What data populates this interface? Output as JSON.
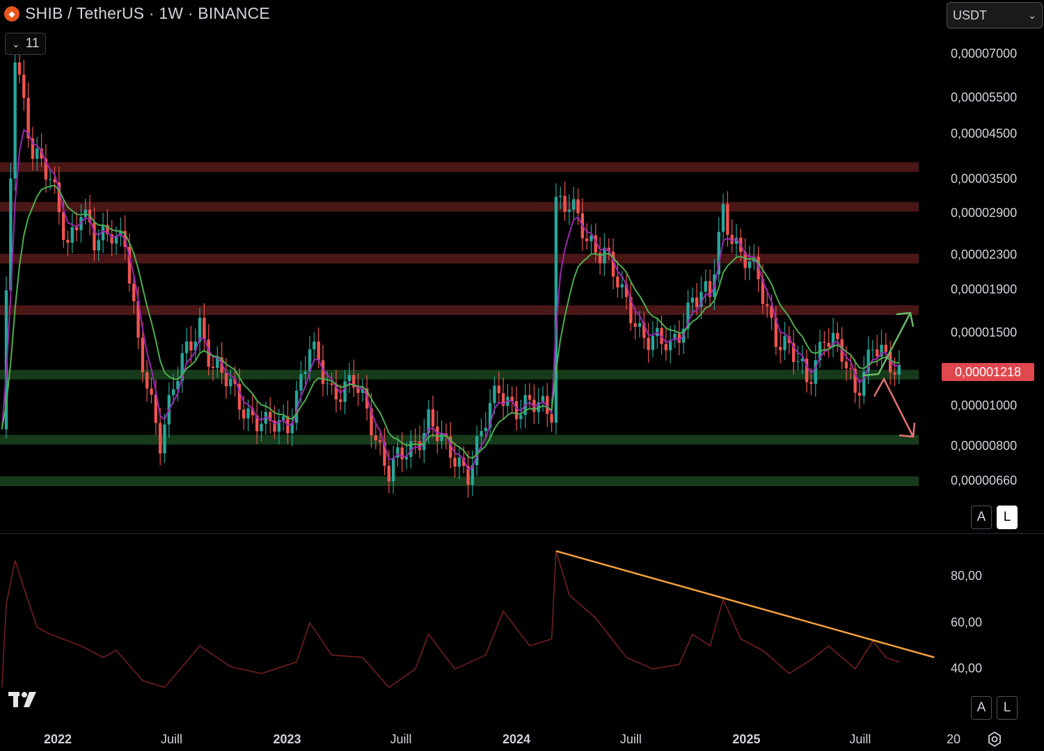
{
  "header": {
    "title": "SHIB / TetherUS · 1W · BINANCE",
    "indicator_count": "11",
    "symbol_icon": "shiba-coin-icon"
  },
  "toolbar": {
    "currency": "USDT"
  },
  "price_axis": {
    "ticks": [
      "0,00007000",
      "0,00005500",
      "0,00004500",
      "0,00003500",
      "0,00002900",
      "0,00002300",
      "0,00001900",
      "0,00001500",
      "0,00001000",
      "0,00000800",
      "0,00000660"
    ],
    "current_price": "0,00001218",
    "scale_buttons": [
      "A",
      "L"
    ]
  },
  "rsi_axis": {
    "ticks": [
      "80,00",
      "60,00",
      "40,00"
    ],
    "scale_buttons": [
      "A",
      "L"
    ]
  },
  "time_axis": {
    "ticks": [
      "2022",
      "Juill",
      "2023",
      "Juill",
      "2024",
      "Juill",
      "2025",
      "Juill",
      "20"
    ]
  },
  "colors": {
    "up": "#26a69a",
    "down": "#ef5350",
    "ma_fast": "#9c27b0",
    "ma_slow": "#4caf50",
    "resistance_zone": "#4a1616",
    "support_zone": "#163a1a",
    "rsi_line": "#7a2020",
    "trendline": "#f5a13c",
    "arrow_up": "#66bb6a",
    "arrow_down": "#e57373",
    "price_tag": "#e0474f"
  },
  "chart_data": [
    {
      "type": "candlestick",
      "title": "SHIB / TetherUS · 1W · BINANCE",
      "x_range": [
        "2021-10",
        "2025-12"
      ],
      "y_scale": "log",
      "y_range": [
        5.6e-06,
        7.5e-05
      ],
      "current_price": 1.218e-05,
      "resistance_zones": [
        3.75e-05,
        3.01e-05,
        2.26e-05,
        1.7e-05
      ],
      "support_zones": [
        1.19e-05,
        8.3e-06,
        6.6e-06
      ],
      "price_path": [
        [
          "2021-10-04",
          8.5e-06
        ],
        [
          "2021-10-25",
          7e-05
        ],
        [
          "2021-11-22",
          4.2e-05
        ],
        [
          "2021-12-20",
          3.4e-05
        ],
        [
          "2022-01-17",
          2.5e-05
        ],
        [
          "2022-02-07",
          3e-05
        ],
        [
          "2022-02-28",
          2.4e-05
        ],
        [
          "2022-03-28",
          2.7e-05
        ],
        [
          "2022-04-18",
          2.5e-05
        ],
        [
          "2022-05-09",
          1.35e-05
        ],
        [
          "2022-06-13",
          8.5e-06
        ],
        [
          "2022-07-04",
          1.1e-05
        ],
        [
          "2022-08-15",
          1.6e-05
        ],
        [
          "2022-09-05",
          1.25e-05
        ],
        [
          "2022-10-03",
          1.1e-05
        ],
        [
          "2022-11-07",
          9.5e-06
        ],
        [
          "2022-11-28",
          8.8e-06
        ],
        [
          "2023-01-02",
          9.2e-06
        ],
        [
          "2023-02-06",
          1.35e-05
        ],
        [
          "2023-03-13",
          1.1e-05
        ],
        [
          "2023-04-17",
          1.12e-05
        ],
        [
          "2023-05-15",
          9.2e-06
        ],
        [
          "2023-06-12",
          7e-06
        ],
        [
          "2023-07-17",
          7.8e-06
        ],
        [
          "2023-08-14",
          9.5e-06
        ],
        [
          "2023-09-11",
          7.7e-06
        ],
        [
          "2023-10-16",
          7.1e-06
        ],
        [
          "2023-11-06",
          8.5e-06
        ],
        [
          "2023-12-04",
          1.1e-05
        ],
        [
          "2024-01-08",
          9.8e-06
        ],
        [
          "2024-02-26",
          1e-05
        ],
        [
          "2024-03-04",
          3.2e-05
        ],
        [
          "2024-03-25",
          3e-05
        ],
        [
          "2024-04-22",
          2.5e-05
        ],
        [
          "2024-05-20",
          2.4e-05
        ],
        [
          "2024-06-17",
          1.8e-05
        ],
        [
          "2024-07-15",
          1.55e-05
        ],
        [
          "2024-08-05",
          1.45e-05
        ],
        [
          "2024-09-02",
          1.35e-05
        ],
        [
          "2024-10-07",
          1.85e-05
        ],
        [
          "2024-11-04",
          1.8e-05
        ],
        [
          "2024-11-25",
          3e-05
        ],
        [
          "2024-12-23",
          2.3e-05
        ],
        [
          "2025-01-20",
          2e-05
        ],
        [
          "2025-02-17",
          1.5e-05
        ],
        [
          "2025-03-17",
          1.3e-05
        ],
        [
          "2025-04-07",
          1.15e-05
        ],
        [
          "2025-05-05",
          1.5e-05
        ],
        [
          "2025-06-02",
          1.3e-05
        ],
        [
          "2025-06-23",
          1.1e-05
        ],
        [
          "2025-07-21",
          1.4e-05
        ],
        [
          "2025-08-11",
          1.25e-05
        ],
        [
          "2025-09-01",
          1.218e-05
        ]
      ],
      "projection_arrows": [
        "up",
        "down"
      ]
    },
    {
      "type": "line",
      "title": "RSI",
      "y_range": [
        28,
        97
      ],
      "values": [
        [
          "2021-10-04",
          32
        ],
        [
          "2021-10-11",
          68
        ],
        [
          "2021-10-25",
          87
        ],
        [
          "2021-11-08",
          75
        ],
        [
          "2021-11-29",
          58
        ],
        [
          "2021-12-20",
          55
        ],
        [
          "2022-02-07",
          50
        ],
        [
          "2022-03-14",
          45
        ],
        [
          "2022-04-04",
          48
        ],
        [
          "2022-05-16",
          35
        ],
        [
          "2022-06-20",
          32
        ],
        [
          "2022-08-15",
          50
        ],
        [
          "2022-10-03",
          41
        ],
        [
          "2022-11-21",
          38
        ],
        [
          "2023-01-16",
          43
        ],
        [
          "2023-02-06",
          60
        ],
        [
          "2023-03-13",
          46
        ],
        [
          "2023-05-01",
          45
        ],
        [
          "2023-06-12",
          32
        ],
        [
          "2023-07-24",
          40
        ],
        [
          "2023-08-14",
          55
        ],
        [
          "2023-09-25",
          40
        ],
        [
          "2023-11-13",
          46
        ],
        [
          "2023-12-11",
          65
        ],
        [
          "2024-01-22",
          50
        ],
        [
          "2024-02-26",
          53
        ],
        [
          "2024-03-04",
          91
        ],
        [
          "2024-03-25",
          72
        ],
        [
          "2024-05-06",
          62
        ],
        [
          "2024-06-24",
          45
        ],
        [
          "2024-08-05",
          40
        ],
        [
          "2024-09-16",
          42
        ],
        [
          "2024-10-07",
          55
        ],
        [
          "2024-11-04",
          50
        ],
        [
          "2024-11-25",
          70
        ],
        [
          "2024-12-23",
          53
        ],
        [
          "2025-01-27",
          48
        ],
        [
          "2025-03-10",
          38
        ],
        [
          "2025-04-14",
          44
        ],
        [
          "2025-05-12",
          50
        ],
        [
          "2025-06-23",
          40
        ],
        [
          "2025-07-21",
          52
        ],
        [
          "2025-08-11",
          45
        ],
        [
          "2025-09-01",
          43
        ]
      ],
      "trendline": [
        [
          "2024-03-04",
          91
        ],
        [
          "2025-10-27",
          45
        ]
      ]
    }
  ]
}
